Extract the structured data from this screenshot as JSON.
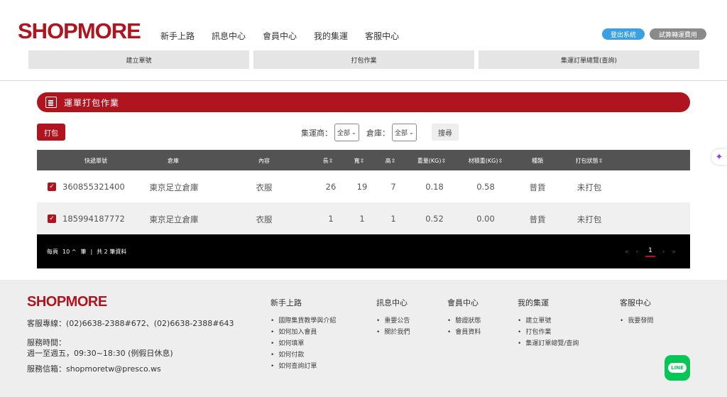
{
  "header": {
    "logo": "SHOPMORE",
    "nav": [
      "新手上路",
      "訊息中心",
      "會員中心",
      "我的集運",
      "客服中心"
    ],
    "logout_label": "登出系統",
    "calc_label": "試算轉運費用",
    "subtabs": [
      "建立單號",
      "打包作業",
      "集運訂單總覽(查詢)"
    ]
  },
  "section": {
    "title": "運單打包作業",
    "pack_button": "打包",
    "filter_agent_label": "集運商：",
    "filter_agent_value": "全部",
    "filter_warehouse_label": "倉庫：",
    "filter_warehouse_value": "全部",
    "search_button": "搜尋"
  },
  "table": {
    "headers": [
      "快遞單號",
      "倉庫",
      "內容",
      "長",
      "寬",
      "高",
      "重量(KG)",
      "材積重(KG)",
      "種類",
      "打包狀態"
    ],
    "rows": [
      [
        "360855321400",
        "東京足立倉庫",
        "衣服",
        "26",
        "19",
        "7",
        "0.18",
        "0.58",
        "普貨",
        "未打包"
      ],
      [
        "185994187772",
        "東京足立倉庫",
        "衣服",
        "1",
        "1",
        "1",
        "0.52",
        "0.00",
        "普貨",
        "未打包"
      ]
    ],
    "footer": {
      "per_page_label": "每頁",
      "per_page_value": "10",
      "unit": "筆",
      "separator": "|",
      "total": "共 2 筆資料",
      "current_page": "1"
    }
  },
  "footer": {
    "logo": "SHOPMORE",
    "hotline": "客服專線：(02)6638-2388#672、(02)6638-2388#643",
    "hours_label": "服務時間：",
    "hours_value": "週一至週五，09:30~18:30 (例假日休息)",
    "email": "服務信箱：shopmoretw@presco.ws",
    "columns": [
      {
        "title": "新手上路",
        "items": [
          "國際集貨教學與介紹",
          "如何加入會員",
          "如何填單",
          "如何付款",
          "如何查詢訂單"
        ]
      },
      {
        "title": "訊息中心",
        "items": [
          "重要公告",
          "關於我們"
        ]
      },
      {
        "title": "會員中心",
        "items": [
          "驗證狀態",
          "會員資料"
        ]
      },
      {
        "title": "我的集運",
        "items": [
          "建立單號",
          "打包作業",
          "集運訂單總覽/查詢"
        ]
      },
      {
        "title": "客服中心",
        "items": [
          "我要發問"
        ]
      }
    ],
    "line_label": "LINE"
  },
  "icons": [
    "clipboard-icon",
    "checkbox-checked-icon",
    "sort-icon",
    "chevron-down-icon",
    "line-icon",
    "sparkle-icon"
  ],
  "colors": {
    "brand": "#b0151f",
    "table_header": "#535353",
    "line_green": "#06c755",
    "logout_blue": "#3aa0e3"
  }
}
